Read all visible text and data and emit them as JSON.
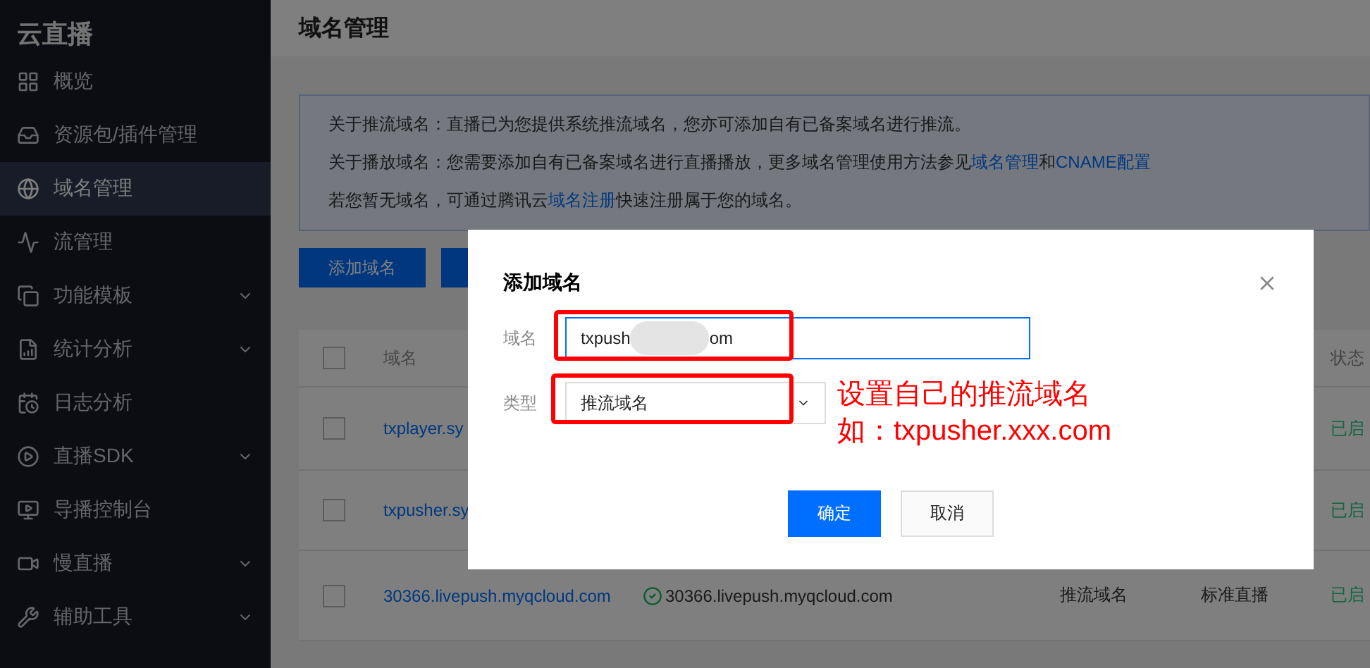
{
  "sidebar": {
    "title": "云直播",
    "items": [
      {
        "label": "概览",
        "kind": "link",
        "selected": false
      },
      {
        "label": "资源包/插件管理",
        "kind": "link",
        "selected": false
      },
      {
        "label": "域名管理",
        "kind": "link",
        "selected": true
      },
      {
        "label": "流管理",
        "kind": "link",
        "selected": false
      },
      {
        "label": "功能模板",
        "kind": "group",
        "selected": false
      },
      {
        "label": "统计分析",
        "kind": "group",
        "selected": false
      },
      {
        "label": "日志分析",
        "kind": "link",
        "selected": false
      },
      {
        "label": "直播SDK",
        "kind": "group",
        "selected": false
      },
      {
        "label": "导播控制台",
        "kind": "link",
        "selected": false
      },
      {
        "label": "慢直播",
        "kind": "group",
        "selected": false
      },
      {
        "label": "辅助工具",
        "kind": "group",
        "selected": false
      }
    ]
  },
  "page": {
    "title": "域名管理"
  },
  "notice": [
    [
      "关于推流域名：直播已为您提供系统推流域名，您亦可添加自有已备案域名进行推流。"
    ],
    [
      "关于播放域名：您需要添加自有已备案域名进行直播播放，更多域名管理使用方法参见",
      {
        "link": "域名管理"
      },
      "和",
      {
        "link": "CNAME配置"
      }
    ],
    [
      "若您暂无域名，可通过腾讯云",
      {
        "link": "域名注册"
      },
      "快速注册属于您的域名。"
    ]
  ],
  "toolbar": {
    "add_button": "添加域名"
  },
  "table": {
    "all_checked": false,
    "columns": [
      "域名",
      "状态"
    ],
    "rows": [
      {
        "checked": false,
        "domain": "txplayer.sy",
        "status": "已启"
      },
      {
        "checked": false,
        "domain": "txpusher.sy",
        "status": "已启"
      },
      {
        "checked": false,
        "domain": "30366.livepush.myqcloud.com",
        "cname": "30366.livepush.myqcloud.com",
        "cname_ok": true,
        "type": "推流域名",
        "service": "标准直播",
        "status": "已启"
      }
    ]
  },
  "dialog": {
    "title": "添加域名",
    "domain_label": "域名",
    "domain_value_start": "txpush",
    "domain_value_end": "om",
    "type_label": "类型",
    "type_value": "推流域名",
    "ok": "确定",
    "cancel": "取消",
    "annotation": [
      "设置自己的推流域名",
      "如：txpusher.xxx.com"
    ]
  }
}
